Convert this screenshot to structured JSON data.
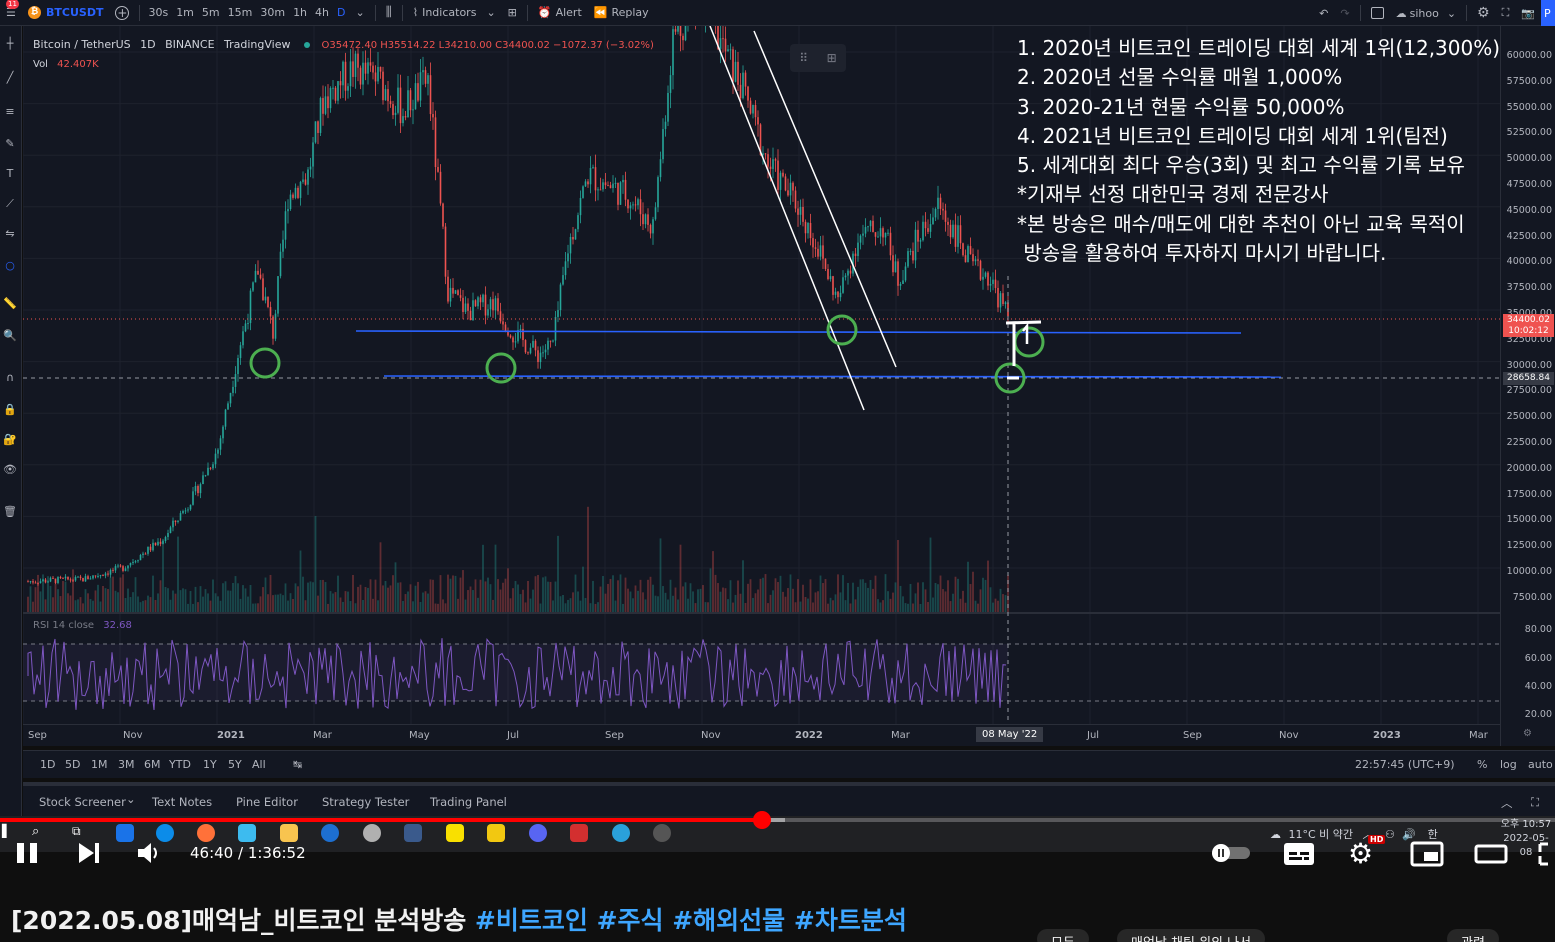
{
  "tv_toolbar": {
    "notification_badge": "11",
    "symbol": "BTCUSDT",
    "intervals": [
      "30s",
      "1m",
      "5m",
      "15m",
      "30m",
      "1h",
      "4h",
      "D"
    ],
    "active_interval": "D",
    "indicators_label": "Indicators",
    "alert_label": "Alert",
    "replay_label": "Replay",
    "layout_name": "sihoo",
    "publish_label": "P"
  },
  "legend": {
    "symbol_title": "Bitcoin / TetherUS",
    "interval": "1D",
    "exchange": "BINANCE",
    "source": "TradingView",
    "ohlc": "O35472.40 H35514.22 L34210.00 C34400.02 −1072.37 (−3.02%)",
    "vol_label": "Vol",
    "vol_value": "42.407K",
    "rsi_label": "RSI 14 close",
    "rsi_value": "32.68"
  },
  "info_text": [
    "1. 2020년 비트코인 트레이딩 대회 세계 1위(12,300%)",
    "2. 2020년 선물 수익률 매월 1,000%",
    "3. 2020-21년 현물 수익률 50,000%",
    "4. 2021년 비트코인 트레이딩 대회 세계 1위(팀전)",
    "5. 세계대회 최다 우승(3회) 및 최고 수익률 기록 보유",
    "*기재부 선정 대한민국 경제 전문강사",
    "*본 방송은 매수/매도에 대한 추천이 아닌 교육 목적이",
    " 방송을 활용하여 투자하지 마시기 바랍니다."
  ],
  "price_axis": {
    "labels": [
      "60000.00",
      "57500.00",
      "55000.00",
      "52500.00",
      "50000.00",
      "47500.00",
      "45000.00",
      "42500.00",
      "40000.00",
      "37500.00",
      "35000.00",
      "32500.00",
      "30000.00",
      "27500.00",
      "25000.00",
      "22500.00",
      "20000.00",
      "17500.00",
      "15000.00",
      "12500.00",
      "10000.00",
      "7500.00"
    ],
    "last_price": "34400.02",
    "countdown": "10:02:12",
    "crosshair_price": "28658.84",
    "rsi_labels": [
      "80.00",
      "60.00",
      "40.00",
      "20.00"
    ]
  },
  "time_axis": {
    "labels": [
      "Sep",
      "Nov",
      "2021",
      "Mar",
      "May",
      "Jul",
      "Sep",
      "Nov",
      "2022",
      "Mar",
      "Jul",
      "Sep",
      "Nov",
      "2023",
      "Mar"
    ],
    "crosshair_date": "08 May '22"
  },
  "range_bar": {
    "ranges": [
      "1D",
      "5D",
      "1M",
      "3M",
      "6M",
      "YTD",
      "1Y",
      "5Y",
      "All"
    ],
    "clock": "22:57:45 (UTC+9)",
    "percent_label": "%",
    "log_label": "log",
    "auto_label": "auto"
  },
  "bottom_tabs": [
    "Stock Screener",
    "Text Notes",
    "Pine Editor",
    "Strategy Tester",
    "Trading Panel"
  ],
  "taskbar": {
    "weather": "11°C 비 약간",
    "ime": "한",
    "clock_time": "오후 10:57",
    "clock_date": "2022-05-08"
  },
  "player": {
    "time": "46:40 / 1:36:52",
    "progress": 0.49,
    "buffered": 0.505,
    "hd_badge": "HD"
  },
  "video": {
    "title_main": "[2022.05.08]매억남_비트코인 분석방송 ",
    "hashtags": "#비트코인 #주식 #해외선물 #차트분석",
    "chips": [
      "모두",
      "매억남 채팅 위의 나서",
      "관련"
    ]
  },
  "colors": {
    "up": "#26a69a",
    "down": "#ef5350",
    "support_line": "#2962ff",
    "marker": "#4caf50",
    "rsi": "#7e57c2"
  }
}
